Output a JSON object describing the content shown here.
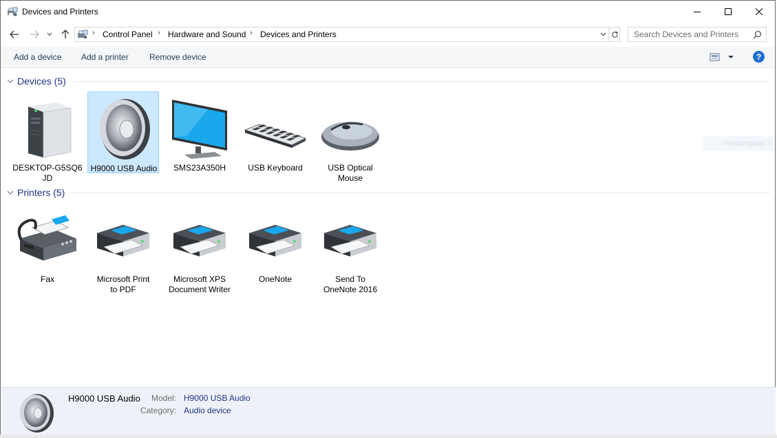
{
  "window": {
    "title": "Devices and Printers"
  },
  "nav": {
    "back_icon": "back-arrow-icon",
    "forward_icon": "forward-arrow-icon",
    "recent_icon": "chevron-down-icon",
    "up_icon": "up-arrow-icon"
  },
  "address": {
    "crumbs": [
      "Control Panel",
      "Hardware and Sound",
      "Devices and Printers"
    ]
  },
  "search": {
    "placeholder": "Search Devices and Printers"
  },
  "commands": {
    "add_device": "Add a device",
    "add_printer": "Add a printer",
    "remove_device": "Remove device",
    "help": "?"
  },
  "groups": {
    "devices": {
      "label": "Devices (5)",
      "items": [
        {
          "name": "DESKTOP-G5SQ6",
          "name2": "JD",
          "icon": "computer-tower-icon"
        },
        {
          "name": "H9000 USB Audio",
          "name2": "",
          "icon": "speaker-icon",
          "selected": true
        },
        {
          "name": "SMS23A350H",
          "name2": "",
          "icon": "monitor-icon"
        },
        {
          "name": "USB Keyboard",
          "name2": "",
          "icon": "keyboard-icon"
        },
        {
          "name": "USB Optical",
          "name2": "Mouse",
          "icon": "mouse-icon"
        }
      ]
    },
    "printers": {
      "label": "Printers (5)",
      "items": [
        {
          "name": "Fax",
          "name2": "",
          "icon": "fax-icon"
        },
        {
          "name": "Microsoft Print",
          "name2": "to PDF",
          "icon": "printer-icon"
        },
        {
          "name": "Microsoft XPS",
          "name2": "Document Writer",
          "icon": "printer-icon"
        },
        {
          "name": "OneNote",
          "name2": "",
          "icon": "printer-icon"
        },
        {
          "name": "Send To",
          "name2": "OneNote 2016",
          "icon": "printer-icon"
        }
      ]
    }
  },
  "ghost_tooltip": "Rectangular S",
  "details": {
    "title": "H9000 USB Audio",
    "model_key": "Model:",
    "model_value": "H9000 USB Audio",
    "category_key": "Category:",
    "category_value": "Audio device"
  },
  "colors": {
    "selection_bg": "#cce8ff",
    "group_header": "#1e3287",
    "command_text": "#1e395b",
    "details_bg": "#eef2f8",
    "help_blue": "#1f6fd1"
  }
}
